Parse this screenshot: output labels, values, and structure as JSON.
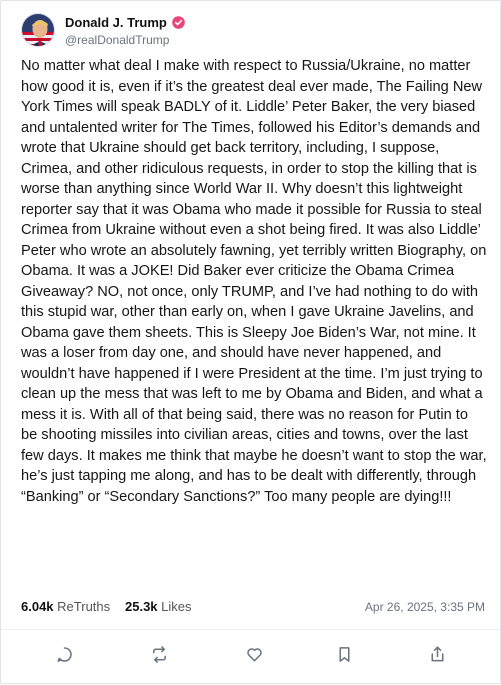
{
  "post": {
    "author": {
      "display_name": "Donald J. Trump",
      "handle": "@realDonaldTrump",
      "verified": true,
      "verified_color": "#e8457a"
    },
    "body": "No matter what deal I make with respect to Russia/Ukraine, no matter how good it is, even if it’s the greatest deal ever made, The Failing New York Times will speak BADLY of it. Liddle’ Peter Baker, the very biased and untalented writer for The Times, followed his Editor’s demands and wrote that Ukraine should get back territory, including, I suppose, Crimea, and other ridiculous requests, in order to stop the killing that is worse than anything since World War II. Why doesn’t this lightweight reporter say that it was Obama who made it possible for Russia to steal Crimea from Ukraine without even a shot being fired. It was also Liddle’ Peter who wrote an absolutely fawning, yet terribly  written Biography, on Obama. It was a JOKE! Did Baker ever criticize the Obama Crimea Giveaway? NO, not once, only TRUMP, and I’ve had nothing to do with this stupid war, other than early on, when I gave Ukraine Javelins, and Obama gave them sheets. This is Sleepy Joe Biden’s War, not mine. It was a loser from day one, and should have never happened, and wouldn’t have happened if I were President at the time. I’m just trying to clean up the mess that was left to me by Obama and Biden, and what a mess it is. With all of that being said, there was no reason for Putin to be shooting missiles into civilian areas, cities and towns, over the last few days. It makes me think that maybe he doesn’t want to stop the war, he’s just tapping me along, and has to be dealt with differently, through “Banking” or “Secondary Sanctions?” Too many people are dying!!!",
    "stats": {
      "retruths_count": "6.04k",
      "retruths_label": "ReTruths",
      "likes_count": "25.3k",
      "likes_label": "Likes"
    },
    "timestamp": "Apr 26, 2025, 3:35 PM"
  },
  "actions": [
    {
      "name": "reply",
      "icon": "comment-icon"
    },
    {
      "name": "retruth",
      "icon": "repost-icon"
    },
    {
      "name": "like",
      "icon": "heart-icon"
    },
    {
      "name": "bookmark",
      "icon": "bookmark-icon"
    },
    {
      "name": "share",
      "icon": "share-icon"
    }
  ],
  "colors": {
    "text": "#161616",
    "muted": "#6b7280",
    "icon": "#6b7280"
  }
}
